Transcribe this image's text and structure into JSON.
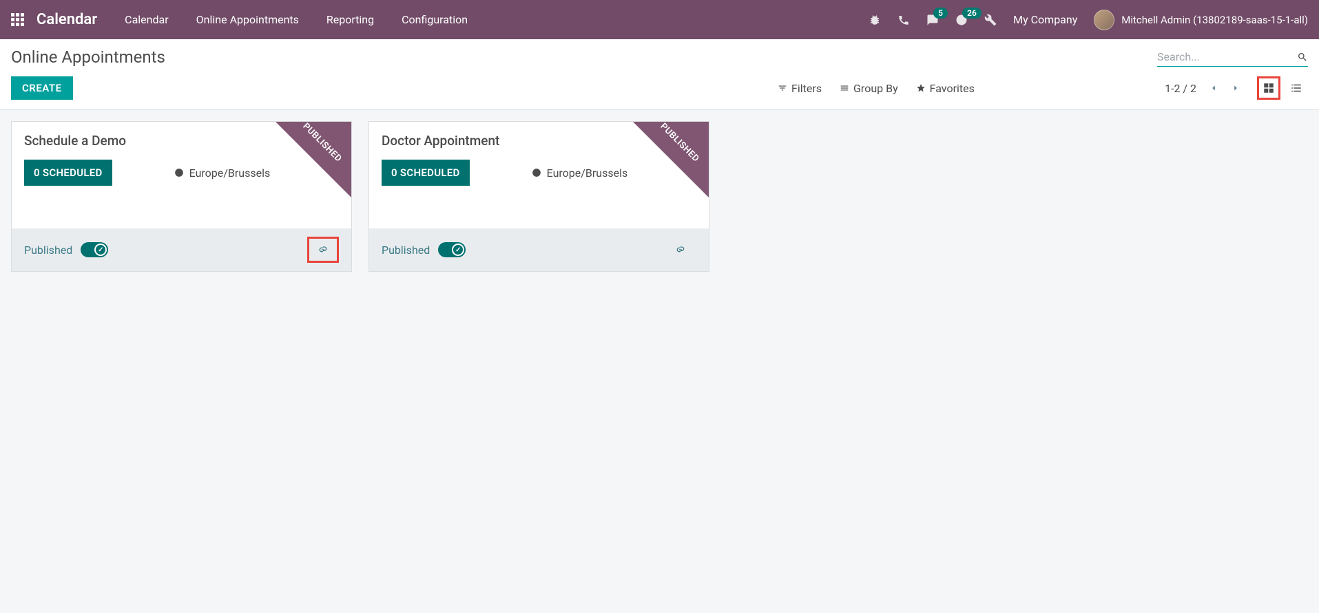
{
  "navbar": {
    "brand": "Calendar",
    "menu": [
      "Calendar",
      "Online Appointments",
      "Reporting",
      "Configuration"
    ],
    "badges": {
      "messages": "5",
      "activities": "26"
    },
    "company": "My Company",
    "user": "Mitchell Admin (13802189-saas-15-1-all)"
  },
  "control": {
    "title": "Online Appointments",
    "create": "CREATE",
    "search_placeholder": "Search...",
    "filters": "Filters",
    "groupby": "Group By",
    "favorites": "Favorites",
    "pager": "1-2 / 2"
  },
  "cards": [
    {
      "title": "Schedule a Demo",
      "scheduled": "0 SCHEDULED",
      "timezone": "Europe/Brussels",
      "ribbon": "PUBLISHED",
      "footer_label": "Published",
      "link_highlighted": true
    },
    {
      "title": "Doctor Appointment",
      "scheduled": "0 SCHEDULED",
      "timezone": "Europe/Brussels",
      "ribbon": "PUBLISHED",
      "footer_label": "Published",
      "link_highlighted": false
    }
  ]
}
